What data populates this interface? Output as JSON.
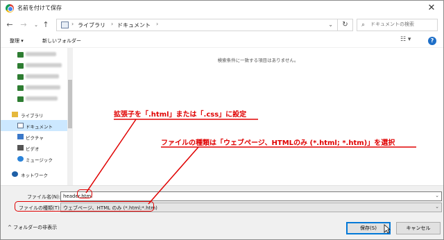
{
  "window": {
    "title": "名前を付けて保存",
    "close_glyph": "✕"
  },
  "nav": {
    "back_glyph": "←",
    "forward_glyph": "→",
    "recent_glyph": "⌄",
    "up_glyph": "↑",
    "breadcrumbs": [
      "ライブラリ",
      "ドキュメント"
    ],
    "breadcrumb_sep": "›",
    "refresh_glyph": "↻",
    "search_placeholder": "ドキュメントの検索"
  },
  "toolbar": {
    "organize_label": "整理 ▾",
    "new_folder_label": "新しいフォルダー",
    "view_glyph": "☷ ▾",
    "help_glyph": "?"
  },
  "sidebar": {
    "items": [
      {
        "label": "",
        "icon": "drive-icon",
        "blurred": true
      },
      {
        "label": "",
        "icon": "drive-icon",
        "blurred": true
      },
      {
        "label": "",
        "icon": "drive-icon",
        "blurred": true
      },
      {
        "label": "",
        "icon": "drive-icon",
        "blurred": true
      },
      {
        "label": "",
        "icon": "drive-icon",
        "blurred": true
      },
      {
        "label": "ライブラリ",
        "icon": "library-icon"
      },
      {
        "label": "ドキュメント",
        "icon": "documents-icon",
        "selected": true
      },
      {
        "label": "ピクチャ",
        "icon": "pictures-icon"
      },
      {
        "label": "ビデオ",
        "icon": "videos-icon"
      },
      {
        "label": "ミュージック",
        "icon": "music-icon"
      },
      {
        "label": "ネットワーク",
        "icon": "network-icon"
      }
    ]
  },
  "content": {
    "empty_message": "検索条件に一致する項目はありません。"
  },
  "fields": {
    "filename_label": "ファイル名(N):",
    "filename_value": "header.html",
    "filetype_label": "ファイルの種類(T):",
    "filetype_value": "ウェブページ、HTML のみ (*.html;*.htm)",
    "dropdown_glyph": "⌄"
  },
  "footer": {
    "hide_folders_label": "^  フォルダーの非表示",
    "save_label": "保存(S)",
    "cancel_label": "キャンセル"
  },
  "annotations": {
    "extension_note": "拡張子を「.html」または「.css」に設定",
    "filetype_note": "ファイルの種類は「ウェブページ、HTMLのみ (*.html; *.htm)」を選択",
    "color": "#e00000"
  }
}
